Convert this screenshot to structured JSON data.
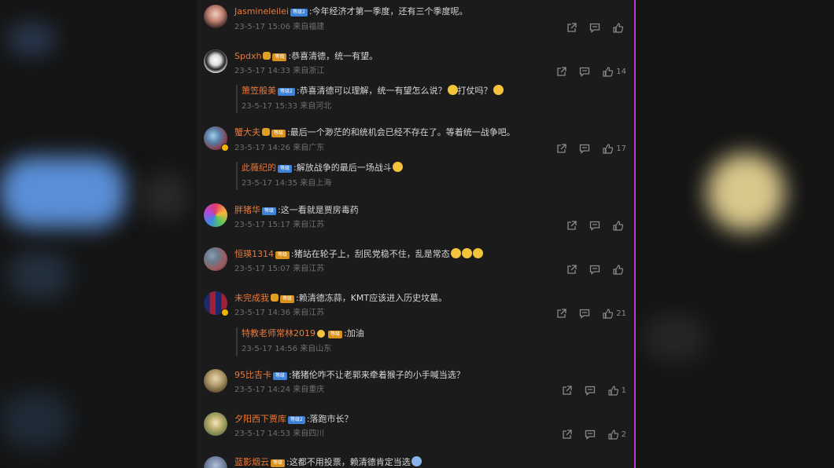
{
  "colors": {
    "username": "#ec7a3a",
    "level_badge_blue": "#3d82d6",
    "level_badge_gold": "#d9901a",
    "divider": "#b43cc8"
  },
  "comments": [
    {
      "user": "Jasmineleilei",
      "level": "等级2",
      "text": ":今年经济才第一季度，还有三个季度呢。",
      "time": "23-5-17 15:06 来自福建",
      "likes": ""
    },
    {
      "user": "Spdxh",
      "level": "等级",
      "text": ":恭喜清德，统一有望。",
      "time": "23-5-17 14:33 来自浙江",
      "likes": "14",
      "reply": {
        "user": "箫笠般美",
        "level": "等级2",
        "text": ":恭喜清德可以理解，统一有望怎么说？",
        "text2": "打仗吗？",
        "time": "23-5-17 15:33 来自河北"
      }
    },
    {
      "user": "蟹大夫",
      "level": "等级",
      "text": ":最后一个渺茫的和统机会已经不存在了。等着统一战争吧。",
      "time": "23-5-17 14:26 来自广东",
      "likes": "17",
      "reply": {
        "user": "此薇纪的",
        "level": "等级",
        "text": ":解放战争的最后一场战斗",
        "time": "23-5-17 14:35 来自上海"
      }
    },
    {
      "user": "胖猪华",
      "level": "等级",
      "text": ":这一看就是贾房毒药",
      "time": "23-5-17 15:17 来自江苏",
      "likes": ""
    },
    {
      "user": "恒瑛1314",
      "level": "等级",
      "text": ":猪站在轮子上，刮民党稳不住，乱是常态",
      "time": "23-5-17 15:07 来自江苏",
      "likes": ""
    },
    {
      "user": "未完成我",
      "level": "等级",
      "text": ":赖清德冻蒜，KMT应该进入历史坟墓。",
      "time": "23-5-17 14:36 来自江苏",
      "likes": "21",
      "reply": {
        "user": "特教老师常林2019",
        "level": "等级",
        "text": ":加油",
        "time": "23-5-17 14:56 来自山东"
      }
    },
    {
      "user": "95比吉卡",
      "level": "等级",
      "text": ":猪猪伦咋不让老郭来牵着猴子的小手喊当选？",
      "time": "23-5-17 14:24 来自重庆",
      "likes": "1"
    },
    {
      "user": "夕阳西下贾库",
      "level": "等级2",
      "text": ":落跑市长？",
      "time": "23-5-17 14:53 来自四川",
      "likes": "2"
    },
    {
      "user": "蓝影烟云",
      "level": "等级",
      "text": ":这都不用投票，赖清德肯定当选",
      "time": "",
      "likes": ""
    }
  ]
}
